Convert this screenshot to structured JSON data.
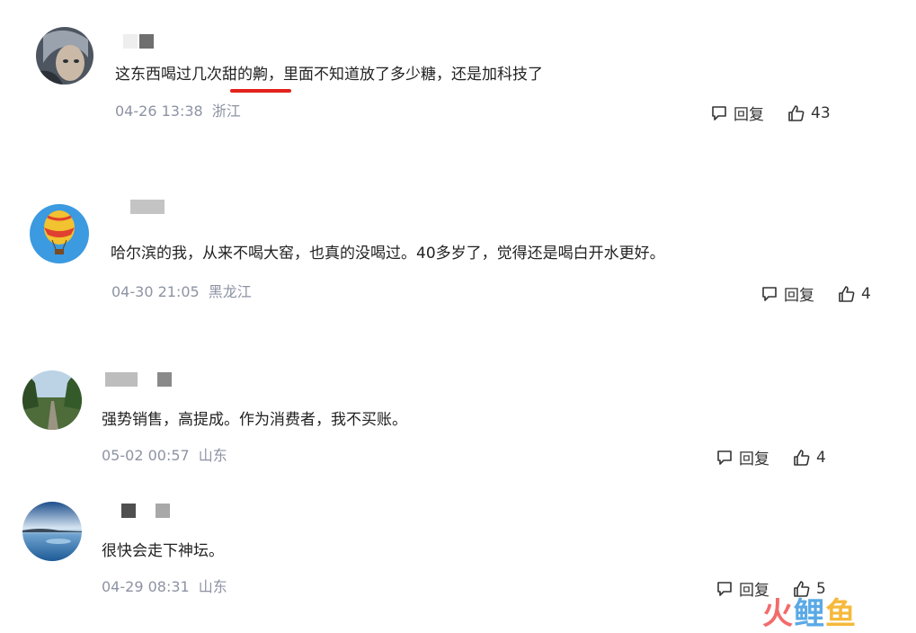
{
  "comments": [
    {
      "text": "这东西喝过几次甜的齁，里面不知道放了多少糖，还是加科技了",
      "date": "04-26 13:38",
      "location": "浙江",
      "reply_label": "回复",
      "likes": "43",
      "avatar": "character-avatar"
    },
    {
      "text": "哈尔滨的我，从来不喝大窑，也真的没喝过。40多岁了，觉得还是喝白开水更好。",
      "date": "04-30 21:05",
      "location": "黑龙江",
      "reply_label": "回复",
      "likes": "4",
      "avatar": "hot-air-balloon-avatar"
    },
    {
      "text": "强势销售，高提成。作为消费者，我不买账。",
      "date": "05-02 00:57",
      "location": "山东",
      "reply_label": "回复",
      "likes": "4",
      "avatar": "forest-road-avatar"
    },
    {
      "text": "很快会走下神坛。",
      "date": "04-29 08:31",
      "location": "山东",
      "reply_label": "回复",
      "likes": "5",
      "avatar": "lake-avatar"
    }
  ],
  "watermark": {
    "part1": "火",
    "part2": "鲤",
    "part3": "鱼"
  },
  "colors": {
    "highlight_underline": "#e3221b",
    "meta_text": "#8d93a3"
  }
}
